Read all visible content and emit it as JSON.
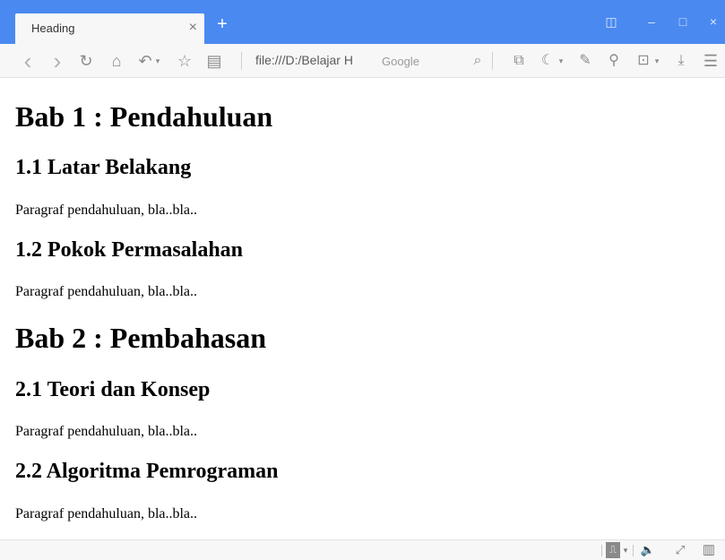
{
  "tab": {
    "title": "Heading",
    "close": "×",
    "new_tab": "+"
  },
  "window_controls": {
    "sidebar": "◫",
    "minimize": "–",
    "maximize": "□",
    "close": "×"
  },
  "toolbar": {
    "back": "‹",
    "forward": "›",
    "reload": "↻",
    "home": "⌂",
    "undo": "↶",
    "dropdown": "▾",
    "bookmark": "☆",
    "reader": "▤",
    "url": "file:///D:/Belajar H",
    "search_placeholder": "Google",
    "search_icon": "⌕",
    "tools": [
      "⧉",
      "☾",
      "✎",
      "⚲",
      "⊡",
      "⤓",
      "☰"
    ]
  },
  "page": {
    "h1_1": "Bab 1 : Pendahuluan",
    "h2_1_1": "1.1 Latar Belakang",
    "p_1_1": "Paragraf pendahuluan, bla..bla..",
    "h2_1_2": "1.2 Pokok Permasalahan",
    "p_1_2": "Paragraf pendahuluan, bla..bla..",
    "h1_2": "Bab 2 : Pembahasan",
    "h2_2_1": "2.1 Teori dan Konsep",
    "p_2_1": "Paragraf pendahuluan, bla..bla..",
    "h2_2_2": "2.2 Algoritma Pemrograman",
    "p_2_2": "Paragraf pendahuluan, bla..bla.."
  },
  "statusbar": {
    "monitor": "⎍",
    "dropdown": "▾",
    "volume": "🔈",
    "fullscreen": "⤢",
    "layout": "▥"
  },
  "colors": {
    "accent": "#4a89f0",
    "toolbar_bg": "#f7f7f7",
    "tab_bg": "#f7f7f7"
  }
}
